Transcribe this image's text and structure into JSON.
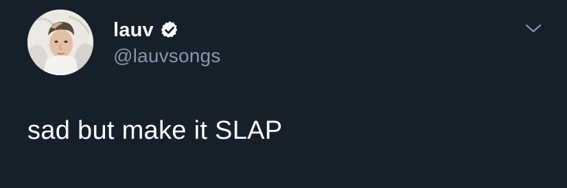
{
  "tweet": {
    "author": {
      "display_name": "lauv",
      "handle": "@lauvsongs",
      "verified": true,
      "avatar_icon": "profile-photo"
    },
    "text": "sad but make it SLAP",
    "menu_icon": "chevron-down-icon"
  },
  "colors": {
    "background": "#15202b",
    "primary_text": "#ffffff",
    "secondary_text": "#8899a6",
    "badge_fill": "#ffffff",
    "badge_check": "#15202b"
  }
}
